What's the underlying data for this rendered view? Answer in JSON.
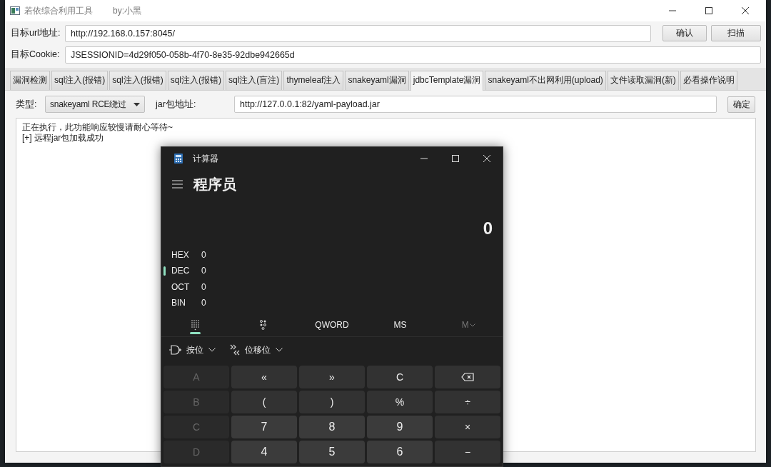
{
  "app_window": {
    "title": "若依综合利用工具",
    "author": "by:小黑",
    "url_label": "目标url地址:",
    "url_value": "http://192.168.0.157:8045/",
    "buttons": [
      "确认",
      "扫描"
    ],
    "cookie_label": "目标Cookie:",
    "cookie_value": "JSESSIONID=4d29f050-058b-4f70-8e35-92dbe942665d",
    "tabs": [
      {
        "label": "漏洞检测",
        "selected": false
      },
      {
        "label": "sql注入(报错)",
        "selected": false
      },
      {
        "label": "sql注入(报错)",
        "selected": false
      },
      {
        "label": "sql注入(报错)",
        "selected": false
      },
      {
        "label": "sql注入(盲注)",
        "selected": false
      },
      {
        "label": "thymeleaf注入",
        "selected": false
      },
      {
        "label": "snakeyaml漏洞",
        "selected": false
      },
      {
        "label": "jdbcTemplate漏洞",
        "selected": true
      },
      {
        "label": "snakeyaml不出网利用(upload)",
        "selected": false
      },
      {
        "label": "文件读取漏洞(新)",
        "selected": false
      },
      {
        "label": "必看操作说明",
        "selected": false
      }
    ],
    "type_label": "类型:",
    "type_value": "snakeyaml RCE绕过",
    "jar_label": "jar包地址:",
    "jar_value": "http://127.0.0.1:82/yaml-payload.jar",
    "submit": "确定",
    "output_lines": [
      "正在执行，此功能响应较慢请耐心等待~",
      "[+] 远程jar包加载成功"
    ]
  },
  "calculator": {
    "title": "计算器",
    "mode": "程序员",
    "display": "0",
    "radix": [
      {
        "label": "HEX",
        "value": "0",
        "selected": false
      },
      {
        "label": "DEC",
        "value": "0",
        "selected": true
      },
      {
        "label": "OCT",
        "value": "0",
        "selected": false
      },
      {
        "label": "BIN",
        "value": "0",
        "selected": false
      }
    ],
    "toolbar": [
      {
        "kind": "keypad",
        "selected": true
      },
      {
        "kind": "bits",
        "selected": false
      },
      {
        "kind": "text",
        "label": "QWORD"
      },
      {
        "kind": "text",
        "label": "MS"
      },
      {
        "kind": "memory",
        "label": "M",
        "disabled": true
      }
    ],
    "bitwise": [
      {
        "kind": "gate",
        "label": "按位"
      },
      {
        "kind": "shift",
        "label": "位移位"
      }
    ],
    "keys": [
      {
        "kind": "hex",
        "label": "A",
        "disabled": true
      },
      {
        "kind": "op",
        "label": "«",
        "disabled": false
      },
      {
        "kind": "op",
        "label": "»",
        "disabled": false
      },
      {
        "kind": "op",
        "label": "C",
        "disabled": false
      },
      {
        "kind": "backspace",
        "disabled": false
      },
      {
        "kind": "hex",
        "label": "B",
        "disabled": true
      },
      {
        "kind": "op",
        "label": "(",
        "disabled": false
      },
      {
        "kind": "op",
        "label": ")",
        "disabled": false
      },
      {
        "kind": "op",
        "label": "%",
        "disabled": false
      },
      {
        "kind": "op",
        "label": "÷",
        "disabled": false
      },
      {
        "kind": "hex",
        "label": "C",
        "disabled": true
      },
      {
        "kind": "digit",
        "label": "7",
        "disabled": false
      },
      {
        "kind": "digit",
        "label": "8",
        "disabled": false
      },
      {
        "kind": "digit",
        "label": "9",
        "disabled": false
      },
      {
        "kind": "op",
        "label": "×",
        "disabled": false
      },
      {
        "kind": "hex",
        "label": "D",
        "disabled": true
      },
      {
        "kind": "digit",
        "label": "4",
        "disabled": false
      },
      {
        "kind": "digit",
        "label": "5",
        "disabled": false
      },
      {
        "kind": "digit",
        "label": "6",
        "disabled": false
      },
      {
        "kind": "op",
        "label": "−",
        "disabled": false
      }
    ]
  }
}
